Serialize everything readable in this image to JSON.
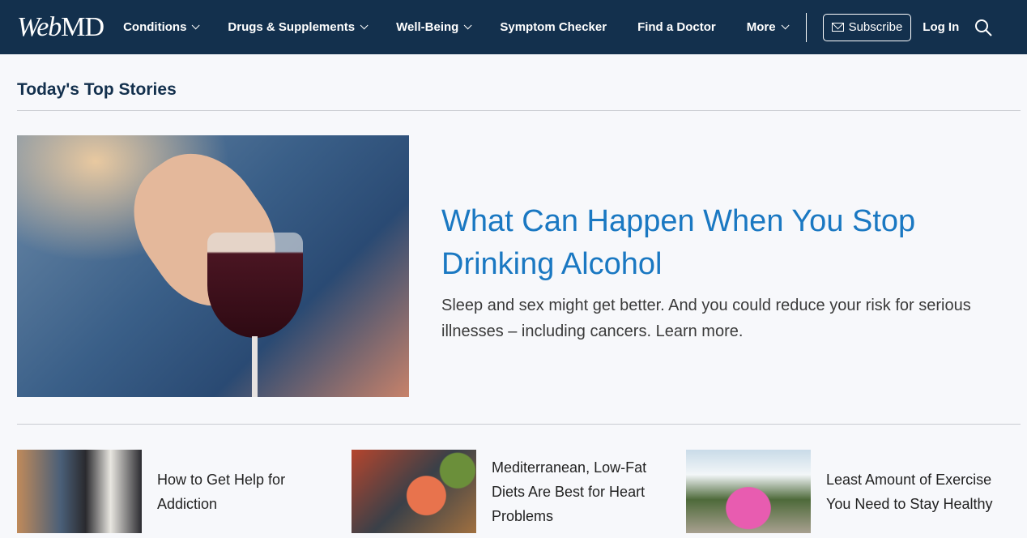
{
  "header": {
    "logo": {
      "web": "Web",
      "md": "MD"
    },
    "nav": [
      {
        "label": "Conditions",
        "dropdown": true
      },
      {
        "label": "Drugs & Supplements",
        "dropdown": true
      },
      {
        "label": "Well-Being",
        "dropdown": true
      },
      {
        "label": "Symptom Checker",
        "dropdown": false
      },
      {
        "label": "Find a Doctor",
        "dropdown": false
      },
      {
        "label": "More",
        "dropdown": true
      }
    ],
    "subscribe_label": "Subscribe",
    "login_label": "Log In"
  },
  "main": {
    "section_title": "Today's Top Stories",
    "hero": {
      "title": "What Can Happen When You Stop Drinking Alcohol",
      "description": "Sleep and sex might get better. And you could reduce your risk for serious illnesses – including cancers. Learn more."
    },
    "stories": [
      {
        "title": "How to Get Help for Addiction"
      },
      {
        "title": "Mediterranean, Low-Fat Diets Are Best for Heart Problems"
      },
      {
        "title": "Least Amount of Exercise You Need to Stay Healthy"
      }
    ]
  }
}
